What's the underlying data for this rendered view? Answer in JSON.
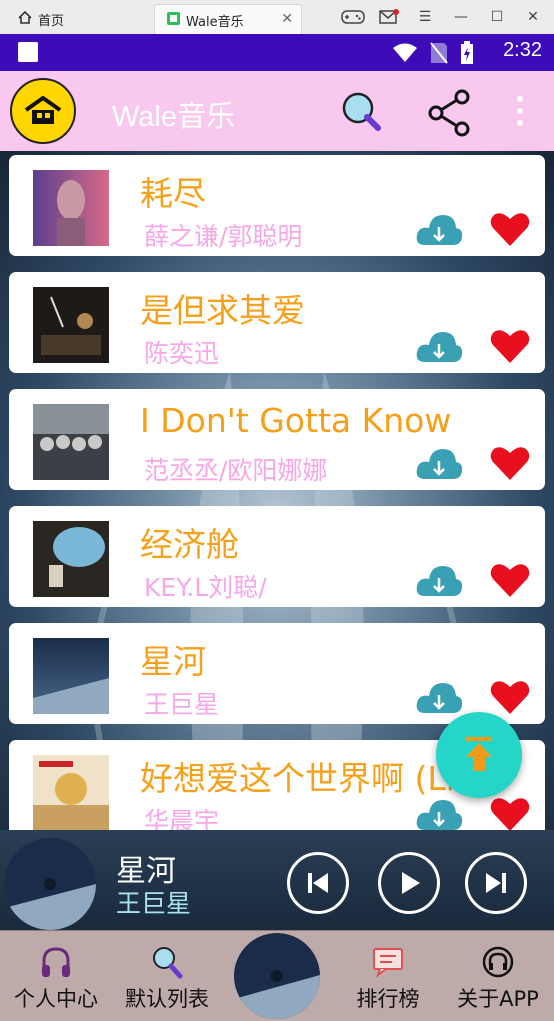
{
  "emulator": {
    "home_tab": "首页",
    "app_tab": "Wale音乐"
  },
  "status_bar": {
    "time": "2:32"
  },
  "app_bar": {
    "title": "Wale音乐"
  },
  "songs": [
    {
      "title": "耗尽",
      "artist": "薛之谦/郭聪明"
    },
    {
      "title": "是但求其爱",
      "artist": "陈奕迅"
    },
    {
      "title": "I Don't Gotta Know",
      "artist": "范丞丞/欧阳娜娜"
    },
    {
      "title": "经济舱",
      "artist": "KEY.L刘聪/"
    },
    {
      "title": "星河",
      "artist": "王巨星"
    },
    {
      "title": "好想爱这个世界啊 (Li",
      "artist": "华晨宇"
    }
  ],
  "player": {
    "song": "星河",
    "artist": "王巨星"
  },
  "bottom_nav": {
    "personal": "个人中心",
    "default_list": "默认列表",
    "ranking": "排行榜",
    "about": "关于APP"
  },
  "colors": {
    "accent_status": "#3d0bb8",
    "appbar": "#f9c8ef",
    "song_title": "#f6a01a",
    "artist": "#f6a7e8",
    "fab": "#24d6c8",
    "heart": "#e8101e",
    "cloud": "#3aa0b4"
  }
}
